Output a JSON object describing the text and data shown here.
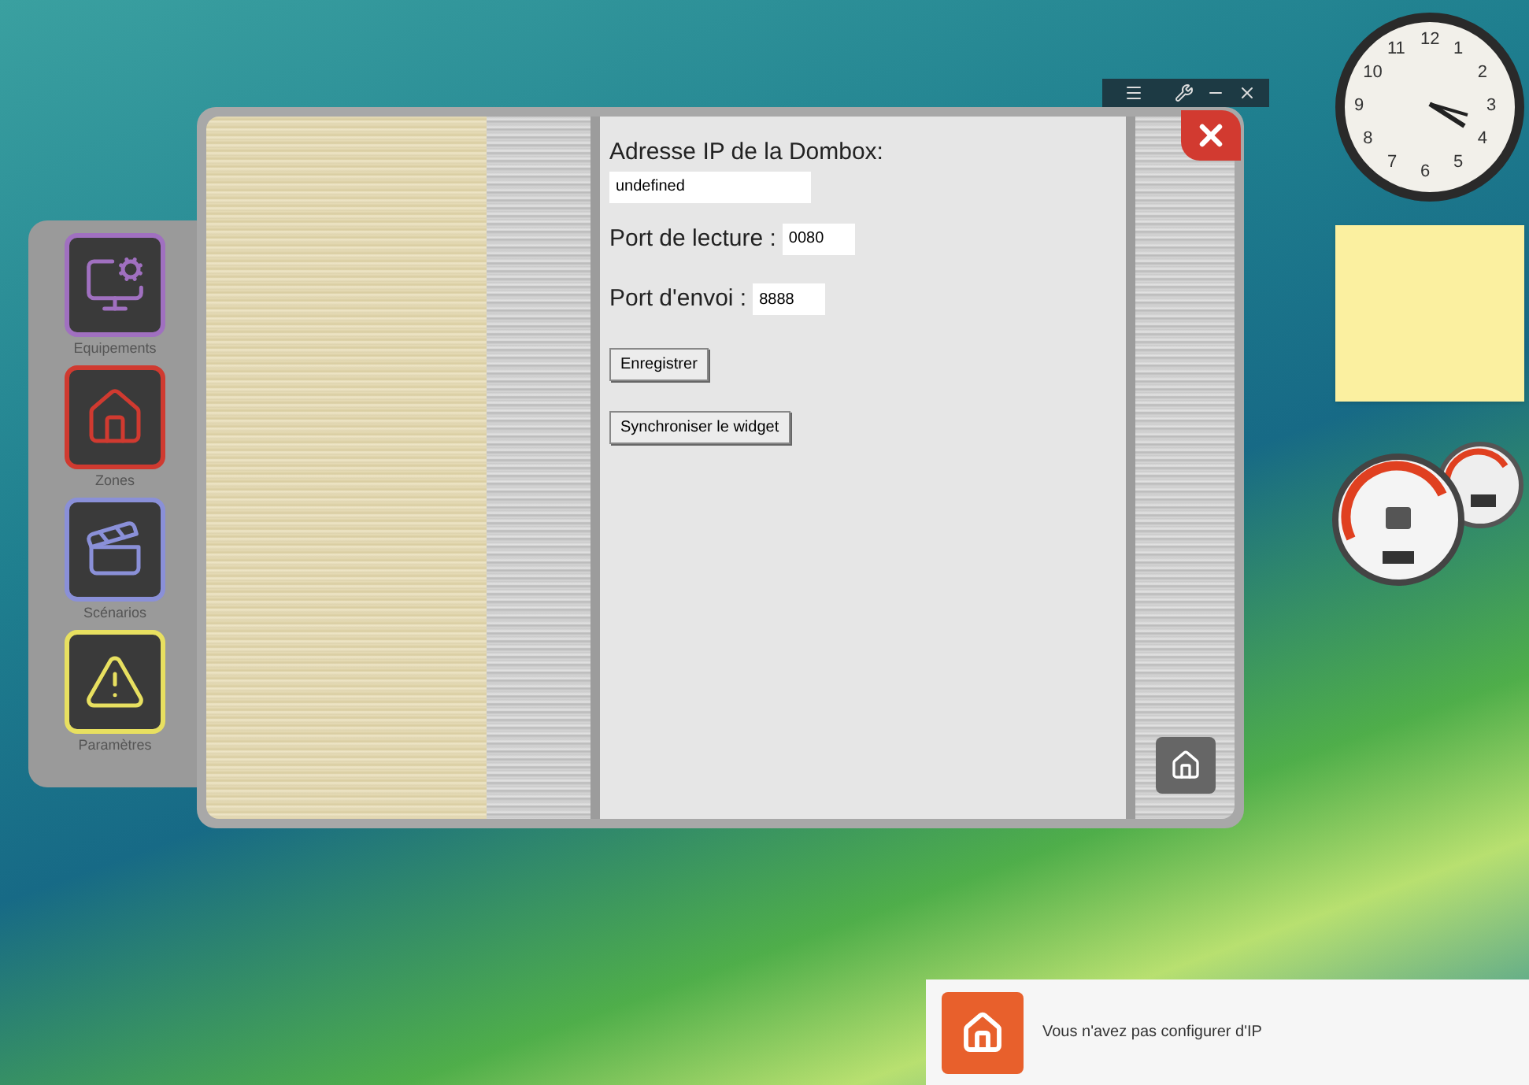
{
  "dock": {
    "items": [
      {
        "label": "Equipements",
        "kind": "devices",
        "color": "#a070c0"
      },
      {
        "label": "Zones",
        "kind": "house",
        "color": "#d03a30"
      },
      {
        "label": "Scénarios",
        "kind": "clapper",
        "color": "#8a90d8"
      },
      {
        "label": "Paramètres",
        "kind": "warning",
        "color": "#e8e060"
      }
    ]
  },
  "settings": {
    "fields": [
      {
        "label": "Adresse IP de la Dombox:",
        "value": "undefined",
        "kind": "wide"
      },
      {
        "label": "Port de lecture :",
        "value": "0080",
        "kind": "inline"
      },
      {
        "label": "Port d'envoi :",
        "value": "8888",
        "kind": "inline"
      }
    ],
    "buttons": [
      "Enregistrer",
      "Synchroniser le widget"
    ]
  },
  "clock": {
    "numbers": [
      "12",
      "1",
      "2",
      "3",
      "4",
      "5",
      "6",
      "7",
      "8",
      "9",
      "10",
      "11"
    ]
  },
  "notification": {
    "message": "Vous n'avez pas configurer d'IP"
  }
}
